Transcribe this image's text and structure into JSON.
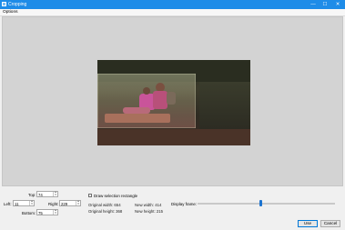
{
  "window": {
    "title": "Cropping",
    "controls": {
      "minimize": "—",
      "maximize": "☐",
      "close": "✕"
    }
  },
  "menu": {
    "options": "Options"
  },
  "crop": {
    "top_label": "Top:",
    "top_value": "74",
    "left_label": "Left:",
    "left_value": "11",
    "right_label": "Right:",
    "right_value": "229",
    "bottom_label": "Bottom:",
    "bottom_value": "75"
  },
  "draw_selection": {
    "label": "Draw selection rectangle",
    "checked": false
  },
  "info": {
    "original_width": "Original width:  654",
    "original_height": "Original height:  368",
    "new_width": "New width:  414",
    "new_height": "New height:  215"
  },
  "display_frame": {
    "label": "Display frame:",
    "position_fraction": 0.46
  },
  "buttons": {
    "use": "Use",
    "cancel": "Cancel"
  },
  "colors": {
    "titlebar": "#1e8ce8",
    "slider_thumb": "#1b73d0",
    "preview_bg": "#d3d3d3"
  },
  "icons": [
    "app-icon",
    "minimize-icon",
    "maximize-icon",
    "close-icon",
    "spin-arrows-icon"
  ]
}
